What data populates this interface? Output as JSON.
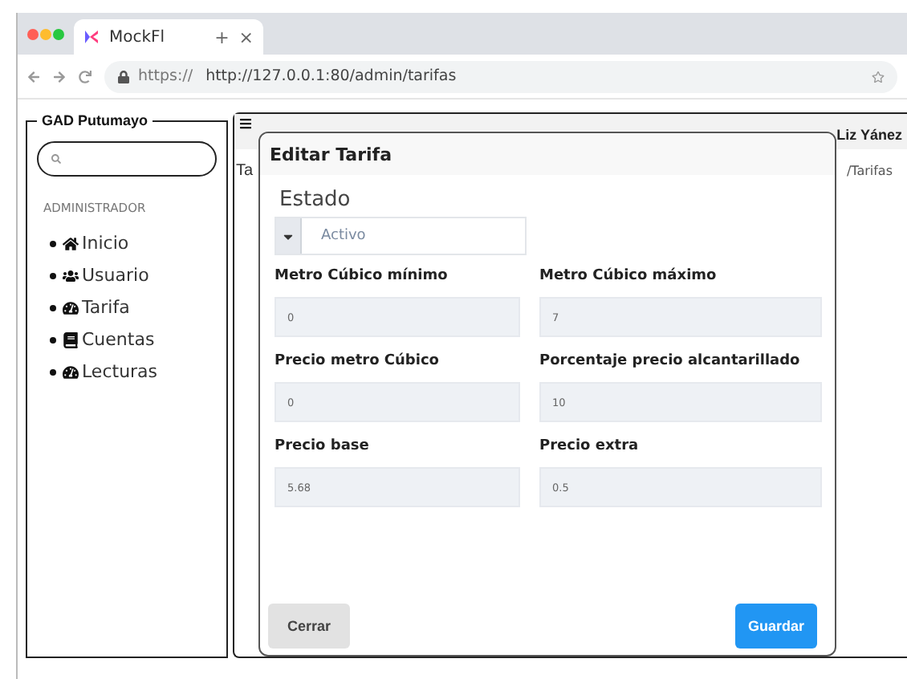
{
  "browser": {
    "tab_title": "MockFl",
    "new_tab": "+",
    "close_tab": "×",
    "url_scheme": "https://",
    "url": "http://127.0.0.1:80/admin/tarifas"
  },
  "sidebar": {
    "title": "GAD Putumayo",
    "section": "ADMINISTRADOR",
    "items": [
      {
        "label": "Inicio",
        "kind": "home"
      },
      {
        "label": "Usuario",
        "kind": "users"
      },
      {
        "label": "Tarifa",
        "kind": "gauge"
      },
      {
        "label": "Cuentas",
        "kind": "book"
      },
      {
        "label": "Lecturas",
        "kind": "gauge"
      }
    ]
  },
  "topbar": {
    "user": "Liz Yánez"
  },
  "page": {
    "title": "Ta",
    "breadcrumb": "/Tarifas"
  },
  "modal": {
    "title": "Editar Tarifa",
    "estado": {
      "label": "Estado",
      "value": "Activo"
    },
    "fields": [
      {
        "label": "Metro Cúbico mínimo",
        "value": "0"
      },
      {
        "label": "Metro Cúbico máximo",
        "value": "7"
      },
      {
        "label": "Precio metro Cúbico",
        "value": "0"
      },
      {
        "label": "Porcentaje precio alcantarillado",
        "value": "10"
      },
      {
        "label": "Precio base",
        "value": "5.68"
      },
      {
        "label": "Precio extra",
        "value": "0.5"
      }
    ],
    "buttons": [
      {
        "label": "Cerrar",
        "kind": "secondary"
      },
      {
        "label": "Guardar",
        "kind": "primary"
      }
    ]
  }
}
